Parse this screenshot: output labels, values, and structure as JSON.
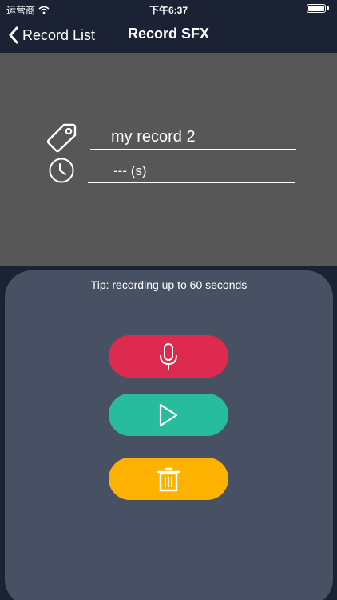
{
  "status_bar": {
    "carrier": "运营商",
    "time": "下午6:37"
  },
  "nav": {
    "back_label": "Record List",
    "title": "Record SFX"
  },
  "record_info": {
    "name_value": "my record 2",
    "duration_text": "--- (s)"
  },
  "controls": {
    "tip": "Tip: recording up to 60 seconds",
    "record_color": "#dd2a4e",
    "play_color": "#27bc9e",
    "delete_color": "#fdb202"
  },
  "icons": {
    "back": "chevron-left-icon",
    "name": "tag-icon",
    "duration": "clock-icon",
    "record": "microphone-icon",
    "play": "play-icon",
    "delete": "trash-icon"
  },
  "colors": {
    "nav_background": "#1b2233",
    "info_background": "#575757",
    "control_background": "#485063"
  }
}
